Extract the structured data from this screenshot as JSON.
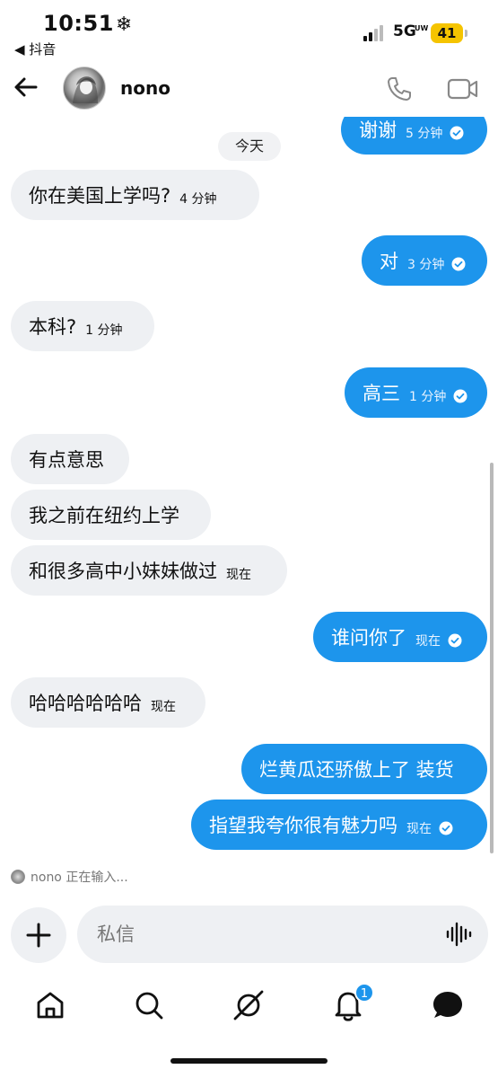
{
  "status_bar": {
    "time": "10:51",
    "weather_symbol": "❄",
    "back_app": "◀ 抖音",
    "network": "5G",
    "network_sub": "UW",
    "battery": "41"
  },
  "header": {
    "contact_name": "nono",
    "icons": [
      "back-arrow-icon",
      "phone-icon",
      "video-camera-icon"
    ]
  },
  "chat": {
    "date_chip": "今天",
    "messages": [
      {
        "dir": "out",
        "text": "谢谢",
        "time": "5 分钟",
        "read": true
      },
      {
        "dir": "in",
        "text": "你在美国上学吗?",
        "time": "4 分钟"
      },
      {
        "dir": "out",
        "text": "对",
        "time": "3 分钟",
        "read": true
      },
      {
        "dir": "in",
        "text": "本科?",
        "time": "1 分钟"
      },
      {
        "dir": "out",
        "text": "高三",
        "time": "1 分钟",
        "read": true
      },
      {
        "dir": "in",
        "text": "有点意思",
        "time": ""
      },
      {
        "dir": "in",
        "text": "我之前在纽约上学",
        "time": ""
      },
      {
        "dir": "in",
        "text": "和很多高中小妹妹做过",
        "time": "现在"
      },
      {
        "dir": "out",
        "text": "谁问你了",
        "time": "现在",
        "read": true
      },
      {
        "dir": "in",
        "text": "哈哈哈哈哈哈",
        "time": "现在"
      },
      {
        "dir": "out",
        "text": "烂黄瓜还骄傲上了 装货",
        "time": ""
      },
      {
        "dir": "out",
        "text": "指望我夸你很有魅力吗",
        "time": "现在",
        "read": true
      }
    ]
  },
  "typing_indicator": "nono 正在输入...",
  "composer": {
    "placeholder": "私信"
  },
  "bottom_nav": {
    "notification_count": "1",
    "items": [
      "home-icon",
      "search-icon",
      "explore-icon",
      "notifications-icon",
      "messages-icon"
    ]
  },
  "colors": {
    "outgoing_bubble": "#1d95ec",
    "incoming_bubble": "#eef0f3",
    "badge": "#1d95ec"
  }
}
